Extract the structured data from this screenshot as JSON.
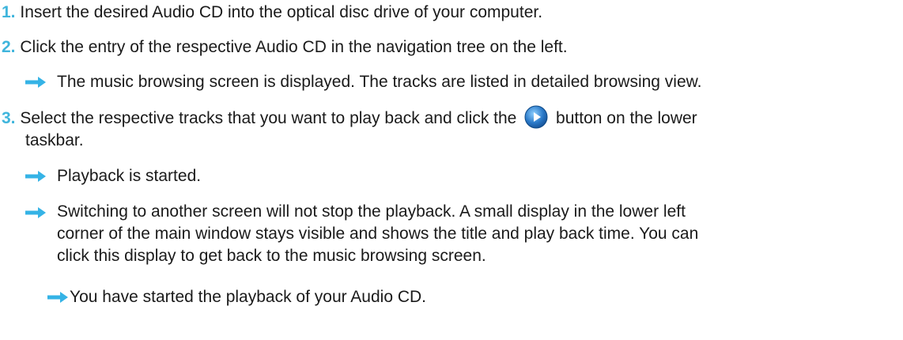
{
  "colors": {
    "step_number": "#3fb5dc",
    "arrow": "#35b3e6",
    "text": "#1a1a1a",
    "play_button": "#2a79c8"
  },
  "steps": [
    {
      "number": "1.",
      "text": "Insert the desired Audio CD into the optical disc drive of your computer."
    },
    {
      "number": "2.",
      "text": "Click the entry of the respective Audio CD in the navigation tree on the left.",
      "result": "The music browsing screen is displayed. The tracks are listed in detailed browsing view."
    },
    {
      "number": "3.",
      "text_before_icon": "Select the respective tracks that you want to play back and click the",
      "text_after_icon": "button on the lower",
      "text_line2": "taskbar.",
      "results": [
        "Playback is started.",
        "Switching to another screen will not stop the playback. A small display in the lower left",
        "corner of the main window stays visible and shows the title and play back time. You can",
        "click this display to get back to the music browsing screen."
      ]
    }
  ],
  "final_result": "You have started the playback of your Audio CD.",
  "icons": {
    "result_arrow": "right-arrow-icon",
    "play_button": "play-button-icon"
  }
}
